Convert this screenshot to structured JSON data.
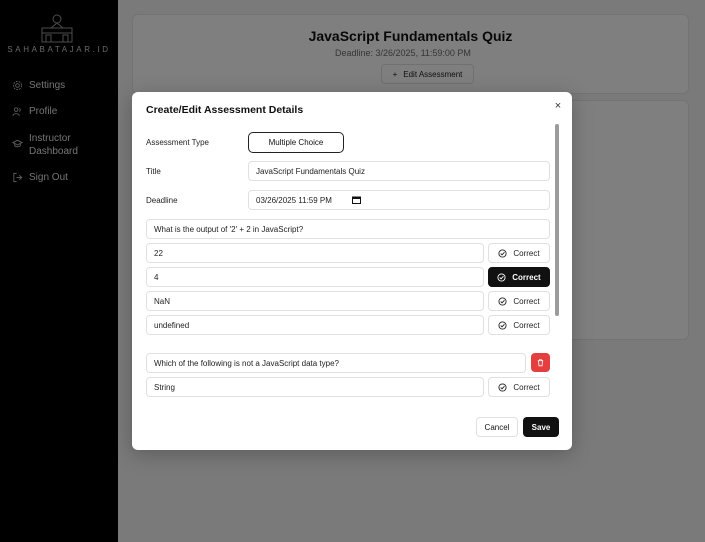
{
  "sidebar": {
    "brand": "SAHABATAJAR.ID",
    "items": [
      {
        "label": "Settings",
        "icon": "gear-icon"
      },
      {
        "label": "Profile",
        "icon": "users-icon"
      },
      {
        "label": "Instructor\nDashboard",
        "icon": "graduation-cap-icon"
      },
      {
        "label": "Sign Out",
        "icon": "sign-out-icon"
      }
    ]
  },
  "page": {
    "title": "JavaScript Fundamentals Quiz",
    "deadline": "Deadline: 3/26/2025, 11:59:00 PM",
    "edit_button": "Edit Assessment"
  },
  "modal": {
    "title": "Create/Edit Assessment Details",
    "close": "×",
    "type_label": "Assessment Type",
    "type_value": "Multiple Choice",
    "title_label": "Title",
    "title_value": "JavaScript Fundamentals Quiz",
    "deadline_label": "Deadline",
    "deadline_value": "03/26/2025 11:59 PM",
    "correct_label": "Correct",
    "questions": [
      {
        "text": "What is the output of '2' + 2 in JavaScript?",
        "options": [
          "22",
          "4",
          "NaN",
          "undefined"
        ],
        "correct_index": 1
      },
      {
        "text": "Which of the following is not a JavaScript data type?",
        "options": [
          "String"
        ],
        "correct_index": -1
      }
    ],
    "cancel": "Cancel",
    "save": "Save"
  }
}
